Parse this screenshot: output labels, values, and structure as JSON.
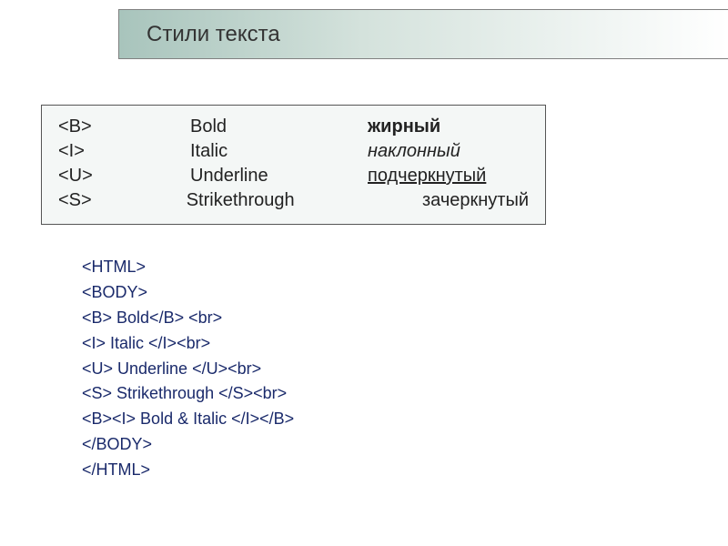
{
  "header": {
    "title": "Стили текста"
  },
  "table": {
    "rows": [
      {
        "tag": "<B>",
        "eng": "Bold",
        "rus": "жирный",
        "style": "bold"
      },
      {
        "tag": "<I>",
        "eng": "Italic",
        "rus": "наклонный",
        "style": "italic"
      },
      {
        "tag": "<U>",
        "eng": "Underline",
        "rus": "подчеркнутый",
        "style": "underline"
      },
      {
        "tag": "<S>",
        "eng": "Strikethrough",
        "rus": "зачеркнутый",
        "style": "strike"
      }
    ]
  },
  "code": {
    "lines": [
      "<HTML>",
      "<BODY>",
      "<B> Bold</B> <br>",
      "<I> Italic </I><br>",
      "<U> Underline </U><br>",
      "<S> Strikethrough </S><br>",
      "<B><I> Bold & Italic </I></B>",
      "</BODY>",
      "</HTML>"
    ]
  }
}
